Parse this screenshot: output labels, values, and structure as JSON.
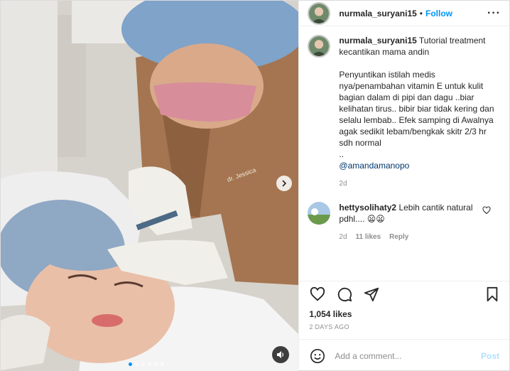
{
  "post": {
    "username": "nurmala_suryani15",
    "separator": "•",
    "follow_label": "Follow",
    "more_label": "···"
  },
  "caption": {
    "username": "nurmala_suryani15",
    "text": " Tutorial treatment kecantikan mama andin\n\nPenyuntikan istilah medis nya/penambahan vitamin E untuk kulit bagian dalam di pipi dan dagu ..biar kelihatan tirus.. bibir biar tidak kering dan selalu lembab.. Efek samping di Awalnya agak sedikit lebam/bengkak skitr 2/3 hr sdh normal\n..\n",
    "mention": "@amandamanopo",
    "age": "2d"
  },
  "comment": {
    "username": "hettysolihaty2",
    "text": " Lebih cantik natural pdhl.... 😦😦",
    "age": "2d",
    "likes": "11 likes",
    "reply_label": "Reply"
  },
  "stats": {
    "likes": "1,054 likes",
    "date": "2 DAYS AGO"
  },
  "composer": {
    "placeholder": "Add a comment...",
    "post_label": "Post"
  },
  "media": {
    "slide_count": 6,
    "active_slide": 1,
    "coat_text": "dr. Jessica"
  },
  "colors": {
    "link": "#0095f6",
    "mention": "#00376b",
    "muted": "#8e8e8e",
    "post_disabled": "#b2dffc"
  },
  "icons": [
    "more-icon",
    "heart-icon",
    "comment-icon",
    "share-icon",
    "bookmark-icon",
    "emoji-icon",
    "audio-icon",
    "chevron-right-icon"
  ]
}
